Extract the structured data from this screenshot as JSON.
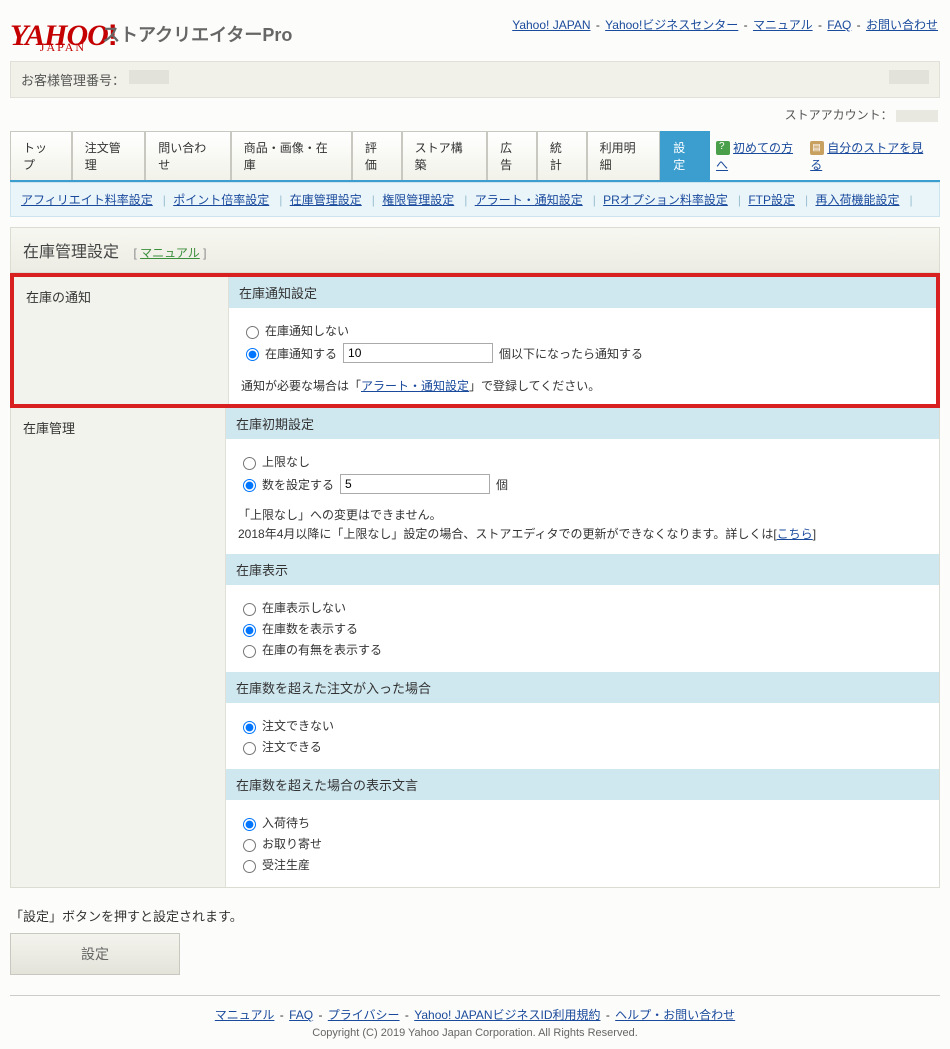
{
  "header": {
    "logo_main": "YAHOO",
    "logo_sub": "JAPAN",
    "product": "ストアクリエイターPro",
    "links": {
      "yj": "Yahoo! JAPAN",
      "bc": "Yahoo!ビジネスセンター",
      "manual": "マニュアル",
      "faq": "FAQ",
      "contact": "お問い合わせ"
    }
  },
  "customer_bar": {
    "label": "お客様管理番号："
  },
  "account_line": {
    "label": "ストアアカウント："
  },
  "tabs": {
    "t0": "トップ",
    "t1": "注文管理",
    "t2": "問い合わせ",
    "t3": "商品・画像・在庫",
    "t4": "評価",
    "t5": "ストア構築",
    "t6": "広告",
    "t7": "統計",
    "t8": "利用明細",
    "t9": "設定",
    "extra_first": "初めての方へ",
    "extra_store": "自分のストアを見る"
  },
  "subnav": {
    "s0": "アフィリエイト料率設定",
    "s1": "ポイント倍率設定",
    "s2": "在庫管理設定",
    "s3": "権限管理設定",
    "s4": "アラート・通知設定",
    "s5": "PRオプション料率設定",
    "s6": "FTP設定",
    "s7": "再入荷機能設定"
  },
  "title": {
    "text": "在庫管理設定",
    "manual_link": "マニュアル"
  },
  "section_notify": {
    "left": "在庫の通知",
    "head": "在庫通知設定",
    "opt_none": "在庫通知しない",
    "opt_do": "在庫通知する",
    "threshold": "10",
    "threshold_suffix": "個以下になったら通知する",
    "note_pre": "通知が必要な場合は「",
    "note_link": "アラート・通知設定",
    "note_post": "」で登録してください。"
  },
  "section_manage": {
    "left": "在庫管理",
    "head_init": "在庫初期設定",
    "opt_nolimit": "上限なし",
    "opt_setnum": "数を設定する",
    "init_value": "5",
    "init_suffix": "個",
    "note_line1": "「上限なし」への変更はできません。",
    "note_line2_pre": "2018年4月以降に「上限なし」設定の場合、ストアエディタでの更新ができなくなります。詳しくは[",
    "note_line2_link": "こちら",
    "note_line2_post": "]",
    "head_disp": "在庫表示",
    "disp_none": "在庫表示しない",
    "disp_count": "在庫数を表示する",
    "disp_flag": "在庫の有無を表示する",
    "head_over": "在庫数を超えた注文が入った場合",
    "over_no": "注文できない",
    "over_yes": "注文できる",
    "head_overtext": "在庫数を超えた場合の表示文言",
    "txt_wait": "入荷待ち",
    "txt_order": "お取り寄せ",
    "txt_made": "受注生産"
  },
  "submit": {
    "hint": "「設定」ボタンを押すと設定されます。",
    "button": "設定"
  },
  "footer": {
    "l0": "マニュアル",
    "l1": "FAQ",
    "l2": "プライバシー",
    "l3": "Yahoo! JAPANビジネスID利用規約",
    "l4": "ヘルプ・お問い合わせ",
    "copyright": "Copyright (C) 2019 Yahoo Japan Corporation. All Rights Reserved."
  }
}
